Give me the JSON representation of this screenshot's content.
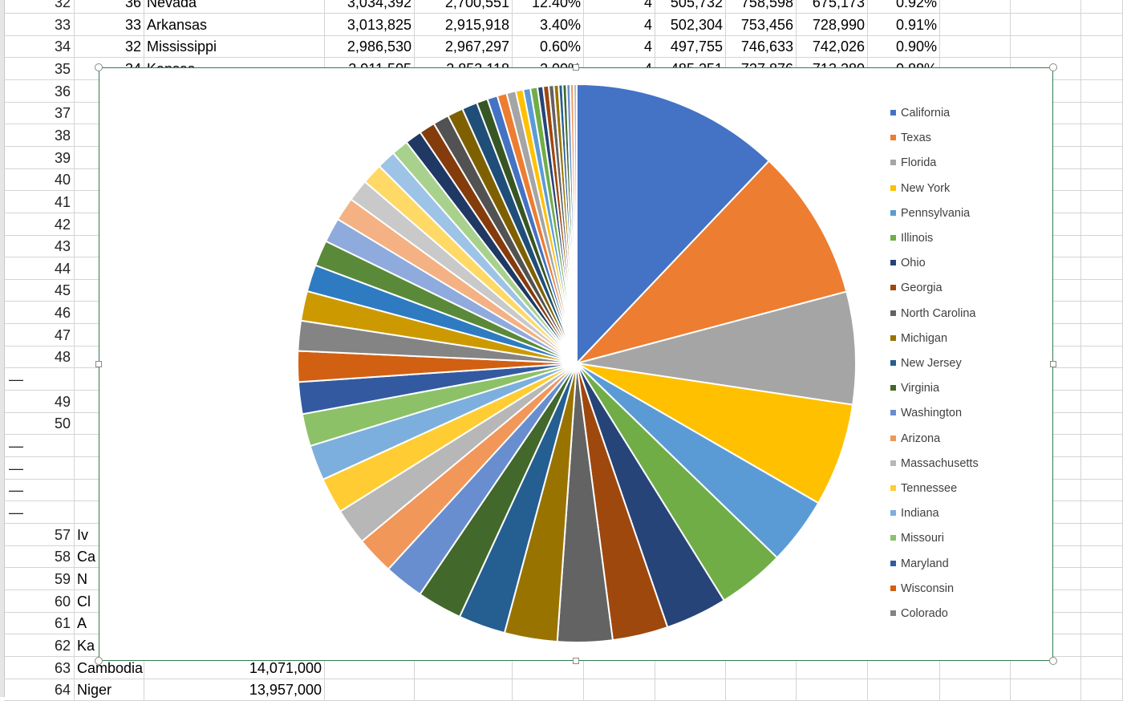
{
  "sheet": {
    "rows": [
      {
        "header": "32",
        "cells": [
          "36",
          "Nevada",
          "3,034,392",
          "2,700,551",
          "12.40%",
          "4",
          "505,732",
          "758,598",
          "675,173",
          "0.92%"
        ]
      },
      {
        "header": "33",
        "cells": [
          "33",
          "Arkansas",
          "3,013,825",
          "2,915,918",
          "3.40%",
          "4",
          "502,304",
          "753,456",
          "728,990",
          "0.91%"
        ]
      },
      {
        "header": "34",
        "cells": [
          "32",
          "Mississippi",
          "2,986,530",
          "2,967,297",
          "0.60%",
          "4",
          "497,755",
          "746,633",
          "742,026",
          "0.90%"
        ]
      },
      {
        "header": "35",
        "cells": [
          "34",
          "Kansas",
          "2,911,505",
          "2,853,118",
          "2.00%",
          "4",
          "485,251",
          "727,876",
          "713,280",
          "0.88%"
        ]
      },
      {
        "header": "36",
        "cells": []
      },
      {
        "header": "37",
        "cells": []
      },
      {
        "header": "38",
        "cells": []
      },
      {
        "header": "39",
        "cells": []
      },
      {
        "header": "40",
        "cells": []
      },
      {
        "header": "41",
        "cells": []
      },
      {
        "header": "42",
        "cells": []
      },
      {
        "header": "43",
        "cells": []
      },
      {
        "header": "44",
        "cells": []
      },
      {
        "header": "45",
        "cells": []
      },
      {
        "header": "46",
        "cells": []
      },
      {
        "header": "47",
        "cells": []
      },
      {
        "header": "48",
        "cells": []
      },
      {
        "header": "—",
        "cells": []
      },
      {
        "header": "49",
        "cells": []
      },
      {
        "header": "50",
        "cells": []
      },
      {
        "header": "—",
        "cells": []
      },
      {
        "header": "—",
        "cells": []
      },
      {
        "header": "—",
        "cells": []
      },
      {
        "header": "—",
        "cells": []
      },
      {
        "header": "57",
        "cells": [
          "Iv"
        ]
      },
      {
        "header": "58",
        "cells": [
          "Ca"
        ]
      },
      {
        "header": "59",
        "cells": [
          "N"
        ]
      },
      {
        "header": "60",
        "cells": [
          "Cl"
        ]
      },
      {
        "header": "61",
        "cells": [
          "A"
        ]
      },
      {
        "header": "62",
        "cells": [
          "Ka"
        ]
      },
      {
        "header": "63",
        "cells": [
          "Cambodia",
          "14,071,000"
        ]
      },
      {
        "header": "64",
        "cells": [
          "Niger",
          "13,957,000"
        ]
      }
    ]
  },
  "chart_data": {
    "type": "pie",
    "start_angle": "12 o'clock, clockwise",
    "legend_position": "right",
    "legend": [
      "California",
      "Texas",
      "Florida",
      "New York",
      "Pennsylvania",
      "Illinois",
      "Ohio",
      "Georgia",
      "North Carolina",
      "Michigan",
      "New Jersey",
      "Virginia",
      "Washington",
      "Arizona",
      "Massachusetts",
      "Tennessee",
      "Indiana",
      "Missouri",
      "Maryland",
      "Wisconsin",
      "Colorado"
    ],
    "values": [
      39557045,
      28701845,
      21299325,
      19542209,
      12807060,
      12741080,
      11689442,
      10519475,
      10383620,
      9995915,
      8908520,
      8517685,
      7535591,
      7171646,
      6902149,
      6770010,
      6691878,
      6126452,
      6042718,
      5813568,
      5695564,
      5611179,
      5084127,
      4887871,
      4659978,
      4468402,
      4190713,
      3943079,
      3572665,
      3190369,
      3156145,
      3034392,
      3013825,
      2986530,
      2911505,
      2095428,
      1929268,
      1805832,
      1754208,
      1420491,
      1356458,
      1338404,
      1062305,
      1057315,
      967171,
      882235,
      760077,
      737438,
      702455,
      626299,
      577737
    ],
    "colors": [
      "#4472C4",
      "#ED7D31",
      "#A5A5A5",
      "#FFC000",
      "#5B9BD5",
      "#70AD47",
      "#264478",
      "#9E480E",
      "#636363",
      "#997300",
      "#255E91",
      "#43682B",
      "#698ED0",
      "#F1975A",
      "#B7B7B7",
      "#FFCD33",
      "#7CAFDD",
      "#8CC168",
      "#335AA1",
      "#D26012",
      "#848484",
      "#CC9A00",
      "#2E7BC2",
      "#5A8A39",
      "#8FAADC",
      "#F4B183",
      "#C9C9C9",
      "#FFD966",
      "#9DC3E6",
      "#A9D18E",
      "#1F3864",
      "#843C0C",
      "#525252",
      "#7F6000",
      "#1F4E79",
      "#375623"
    ]
  }
}
